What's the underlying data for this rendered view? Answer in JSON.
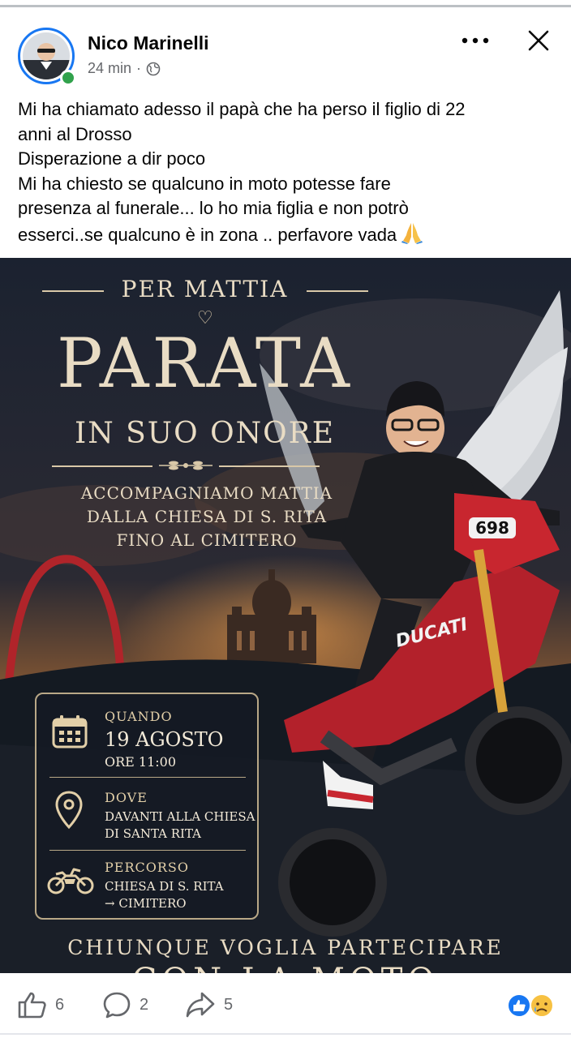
{
  "post": {
    "author": "Nico Marinelli",
    "time": "24 min",
    "separator": "·",
    "privacy_icon": "globe-icon",
    "text_lines": [
      "Mi ha chiamato adesso il papà che ha perso il figlio di 22",
      "anni al Drosso",
      "Disperazione a dir poco",
      "Mi ha chiesto se qualcuno in moto potesse fare",
      "presenza al funerale... lo ho mia figlia e non potrò",
      "esserci..se qualcuno è in zona .. perfavore vada"
    ],
    "emoji": "folded-hands-emoji"
  },
  "poster": {
    "per": "PER MATTIA",
    "heart": "♡",
    "title": "PARATA",
    "subtitle": "IN SUO ONORE",
    "accompany": [
      "ACCOMPAGNIAMO MATTIA",
      "DALLA CHIESA DI S. RITA",
      "FINO AL CIMITERO"
    ],
    "quando_label": "QUANDO",
    "quando_date": "19 AGOSTO",
    "quando_time": "ORE 11:00",
    "dove_label": "DOVE",
    "dove_lines": [
      "DAVANTI ALLA CHIESA",
      "DI SANTA RITA"
    ],
    "percorso_label": "PERCORSO",
    "percorso_lines": [
      "CHIESA DI S. RITA",
      "→ CIMITERO"
    ],
    "footer": "CHIUNQUE VOGLIA PARTECIPARE",
    "footer2": "CON LA MOTO",
    "bike_number": "698",
    "bike_brand": "DUCATI"
  },
  "actions": {
    "likes": "6",
    "comments": "2",
    "shares": "5"
  },
  "colors": {
    "accent": "#1877f2",
    "online": "#31a24c",
    "poster_text": "#e9dcc4"
  }
}
